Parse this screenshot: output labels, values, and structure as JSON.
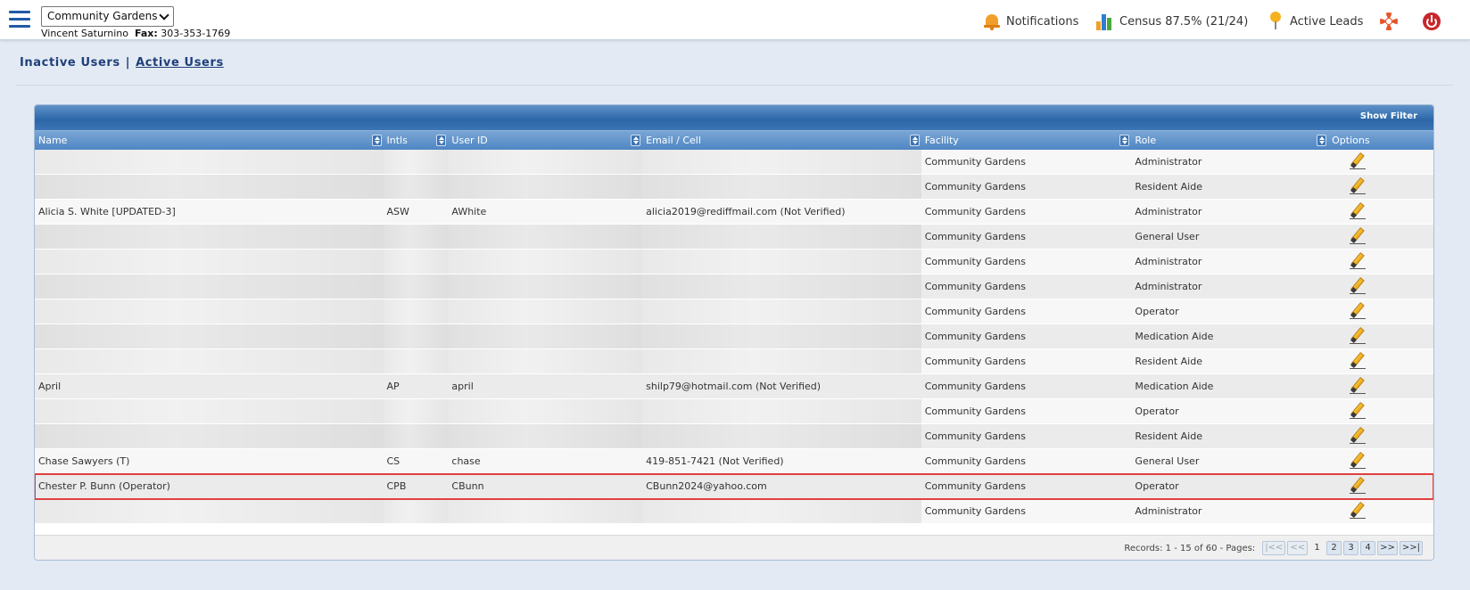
{
  "header": {
    "facility_selected": "Community Gardens",
    "user_name": "Vincent Saturnino",
    "fax_label": "Fax:",
    "fax_number": "303-353-1769",
    "notifications_label": "Notifications",
    "census_label": "Census 87.5% (21/24)",
    "active_leads_label": "Active Leads"
  },
  "tabs": {
    "inactive_label": "Inactive Users",
    "separator": "|",
    "active_label": "Active Users"
  },
  "grid": {
    "show_filter_label": "Show Filter",
    "columns": [
      "Name",
      "Intls",
      "User ID",
      "Email / Cell",
      "Facility",
      "Role",
      "Options"
    ],
    "rows": [
      {
        "name": "",
        "intls": "",
        "user_id": "",
        "email": "",
        "facility": "Community Gardens",
        "role": "Administrator"
      },
      {
        "name": "",
        "intls": "",
        "user_id": "",
        "email": "",
        "facility": "Community Gardens",
        "role": "Resident Aide"
      },
      {
        "name": "Alicia S. White [UPDATED-3]",
        "intls": "ASW",
        "user_id": "AWhite",
        "email": "alicia2019@rediffmail.com (Not Verified)",
        "facility": "Community Gardens",
        "role": "Administrator"
      },
      {
        "name": "",
        "intls": "",
        "user_id": "",
        "email": "",
        "facility": "Community Gardens",
        "role": "General User"
      },
      {
        "name": "",
        "intls": "",
        "user_id": "",
        "email": "",
        "facility": "Community Gardens",
        "role": "Administrator"
      },
      {
        "name": "",
        "intls": "",
        "user_id": "",
        "email": "",
        "facility": "Community Gardens",
        "role": "Administrator"
      },
      {
        "name": "",
        "intls": "",
        "user_id": "",
        "email": "",
        "facility": "Community Gardens",
        "role": "Operator"
      },
      {
        "name": "",
        "intls": "",
        "user_id": "",
        "email": "",
        "facility": "Community Gardens",
        "role": "Medication Aide"
      },
      {
        "name": "",
        "intls": "",
        "user_id": "",
        "email": "",
        "facility": "Community Gardens",
        "role": "Resident Aide"
      },
      {
        "name": "April",
        "intls": "AP",
        "user_id": "april",
        "email": "shilp79@hotmail.com (Not Verified)",
        "facility": "Community Gardens",
        "role": "Medication Aide"
      },
      {
        "name": "",
        "intls": "",
        "user_id": "",
        "email": "",
        "facility": "Community Gardens",
        "role": "Operator"
      },
      {
        "name": "",
        "intls": "",
        "user_id": "",
        "email": "",
        "facility": "Community Gardens",
        "role": "Resident Aide"
      },
      {
        "name": "Chase Sawyers (T)",
        "intls": "CS",
        "user_id": "chase",
        "email": "419-851-7421 (Not Verified)",
        "facility": "Community Gardens",
        "role": "General User"
      },
      {
        "name": "Chester P. Bunn (Operator)",
        "intls": "CPB",
        "user_id": "CBunn",
        "email": "CBunn2024@yahoo.com",
        "facility": "Community Gardens",
        "role": "Operator"
      },
      {
        "name": "",
        "intls": "",
        "user_id": "",
        "email": "",
        "facility": "Community Gardens",
        "role": "Administrator"
      }
    ]
  },
  "pager": {
    "records_text": "Records: 1 - 15 of 60 - Pages:",
    "first": "|<<",
    "prev": "<<",
    "current_page": "1",
    "pages": [
      "2",
      "3",
      "4"
    ],
    "next": ">>",
    "last": ">>|"
  }
}
